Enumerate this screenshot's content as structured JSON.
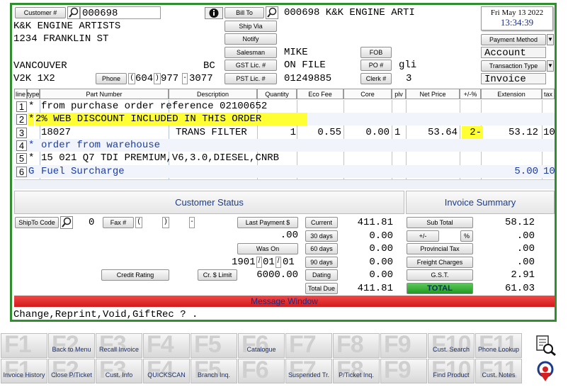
{
  "customer": {
    "btn_label": "Customer #",
    "number": "000698",
    "name": "K&K ENGINE ARTISTS",
    "address": "1234 FRANKLIN ST",
    "city": "VANCOUVER",
    "province": "BC",
    "postal": "V2K 1X2",
    "phone_btn": "Phone",
    "phone_area": "604",
    "phone_prefix": "977",
    "phone_line": "3077"
  },
  "middle": {
    "bill_to": "Bill To",
    "ship_via": "Ship Via",
    "notify": "Notify",
    "salesman": "Salesman",
    "gst_lic": "GST Lic. #",
    "pst_lic": "PST Lic. #",
    "bill_to_value": "000698 K&K ENGINE ARTI",
    "salesman_value": "MIKE",
    "gst_value": "ON FILE",
    "pst_value": "01249885",
    "fob": "FOB",
    "po": "PO #",
    "clerk": "Clerk #",
    "po_value": "gli",
    "clerk_value": "3"
  },
  "right": {
    "date": "Fri May 13 2022",
    "time": "13:34:39",
    "payment_method": "Payment Method",
    "payment_value": "Account",
    "transaction_type": "Transaction Type",
    "transaction_value": "Invoice"
  },
  "grid": {
    "headers": [
      "line",
      "type",
      "Part Number",
      "Description",
      "Quantity",
      "Eco Fee",
      "Core",
      "plv",
      "Net Price",
      "+/-%",
      "Extension",
      "tax"
    ],
    "rows": [
      {
        "line": "1",
        "type": "*",
        "text": "from purchase order reference 02100652",
        "hl": false
      },
      {
        "line": "2",
        "type": "*",
        "text": " 2% WEB DISCOUNT INCLUDED IN THIS ORDER",
        "hl": true
      },
      {
        "line": "3",
        "type": "",
        "part": "18027",
        "desc": "TRANS FILTER",
        "qty": "1",
        "eco": "0.55",
        "core": "0.00",
        "plv": "1",
        "net": "53.64",
        "pct": "2-",
        "ext": "53.12",
        "tax": "10"
      },
      {
        "line": "4",
        "type": "*",
        "text": "order from warehouse",
        "hl": false,
        "blue": true
      },
      {
        "line": "5",
        "type": "*",
        "text": "15 021 Q7 TDI PREMIUM,V6,3.0,DIESEL,CNRB",
        "hl": false
      },
      {
        "line": "6",
        "type": "G",
        "text": "Fuel Surcharge",
        "ext": "5.00",
        "tax": "10",
        "blue": true
      }
    ]
  },
  "status": {
    "title": "Customer Status",
    "shipto": "ShipTo Code",
    "shipto_val": "0",
    "fax": "Fax #",
    "last_payment": "Last Payment $",
    "last_payment_val": ".00",
    "was_on": "Was On",
    "was_on_y": "1901",
    "was_on_m": "01",
    "was_on_d": "01",
    "credit_rating": "Credit Rating",
    "cr_limit": "Cr. $ Limit",
    "cr_limit_val": "6000.00",
    "aging": [
      {
        "label": "Current",
        "val": "411.81"
      },
      {
        "label": "30 days",
        "val": "0.00"
      },
      {
        "label": "60 days",
        "val": "0.00"
      },
      {
        "label": "90 days",
        "val": "0.00"
      },
      {
        "label": "Dating",
        "val": "0.00"
      },
      {
        "label": "Total Due",
        "val": "411.81"
      }
    ]
  },
  "summary": {
    "title": "Invoice Summary",
    "sub_total": "Sub Total",
    "sub_total_val": "58.12",
    "plus_minus": "+/-",
    "pct": "%",
    "pm_val": ".00",
    "prov_tax": "Provincial Tax",
    "prov_tax_val": ".00",
    "freight": "Freight Charges",
    "freight_val": ".00",
    "gst": "G.S.T.",
    "gst_val": "2.91",
    "total": "TOTAL",
    "total_val": "61.03"
  },
  "message": {
    "title": "Message Window",
    "text": "Change,Reprint,Void,GiftRec   ?    ."
  },
  "fkeys_top": [
    {
      "k": "F1",
      "l": ""
    },
    {
      "k": "F2",
      "l": "Back to Menu"
    },
    {
      "k": "F3",
      "l": "Recall Invoice"
    },
    {
      "k": "F4",
      "l": ""
    },
    {
      "k": "F5",
      "l": ""
    },
    {
      "k": "F6",
      "l": "Catalogue"
    },
    {
      "k": "F7",
      "l": ""
    },
    {
      "k": "F8",
      "l": ""
    },
    {
      "k": "F9",
      "l": ""
    },
    {
      "k": "F10",
      "l": "Cust. Search"
    },
    {
      "k": "F11",
      "l": "Phone Lookup"
    }
  ],
  "fkeys_bot": [
    {
      "k": "F1",
      "l": "Invoice History"
    },
    {
      "k": "F2",
      "l": "Close P/Ticket"
    },
    {
      "k": "F3",
      "l": "Cust. Info"
    },
    {
      "k": "F4",
      "l": "QUICKSCAN"
    },
    {
      "k": "F5",
      "l": "Branch Inq."
    },
    {
      "k": "F6",
      "l": ""
    },
    {
      "k": "F7",
      "l": "Suspended Tr."
    },
    {
      "k": "F8",
      "l": "P/Ticket Inq."
    },
    {
      "k": "F9",
      "l": ""
    },
    {
      "k": "F10",
      "l": "Find Product"
    },
    {
      "k": "F11",
      "l": "Cust. Notes"
    }
  ]
}
